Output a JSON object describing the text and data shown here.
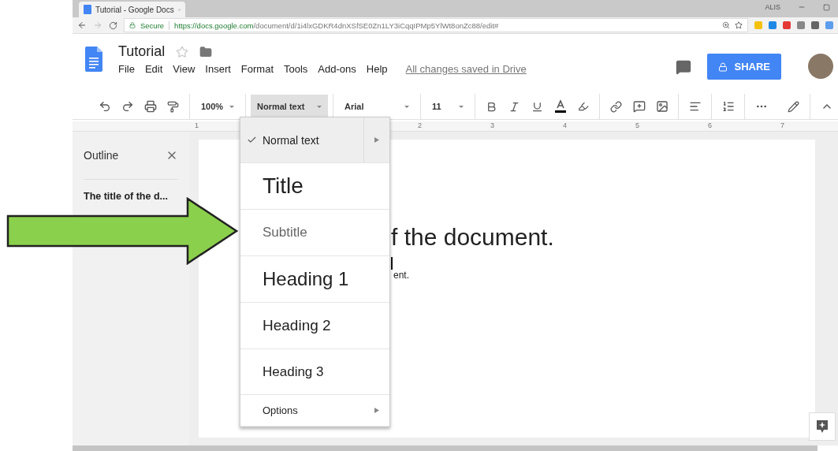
{
  "browser": {
    "tab": {
      "title": "Tutorial - Google Docs",
      "selected": true
    },
    "profile": "ALIS",
    "secure_label": "Secure",
    "url_host": "https://docs.google.com",
    "url_path": "/document/d/1i4lxGDKR4dnXSfSE0Zn1LY3iCqqIPMp5YlWt8onZc88/edit#"
  },
  "docs": {
    "title": "Tutorial",
    "menu": [
      "File",
      "Edit",
      "View",
      "Insert",
      "Format",
      "Tools",
      "Add-ons",
      "Help"
    ],
    "save_status": "All changes saved in Drive",
    "share": "SHARE"
  },
  "toolbar": {
    "zoom": "100%",
    "style": {
      "label": "Normal text",
      "open": true
    },
    "font": "Arial",
    "size": "11"
  },
  "ruler": [
    "1",
    "2",
    "3",
    "4",
    "5",
    "6",
    "7"
  ],
  "outline": {
    "title": "Outline",
    "items": [
      "The title of the d..."
    ]
  },
  "style_menu": [
    {
      "kind": "normal",
      "label": "Normal text",
      "selected": true
    },
    {
      "kind": "title",
      "label": "Title",
      "selected": false
    },
    {
      "kind": "subtitle",
      "label": "Subtitle",
      "selected": false
    },
    {
      "kind": "heading1",
      "label": "Heading 1",
      "selected": false
    },
    {
      "kind": "heading2",
      "label": "Heading 2",
      "selected": false
    },
    {
      "kind": "heading3",
      "label": "Heading 3",
      "selected": false
    },
    {
      "kind": "submenu",
      "label": "Options",
      "selected": false
    }
  ],
  "document": {
    "heading": "f the document.",
    "body": "ent."
  }
}
